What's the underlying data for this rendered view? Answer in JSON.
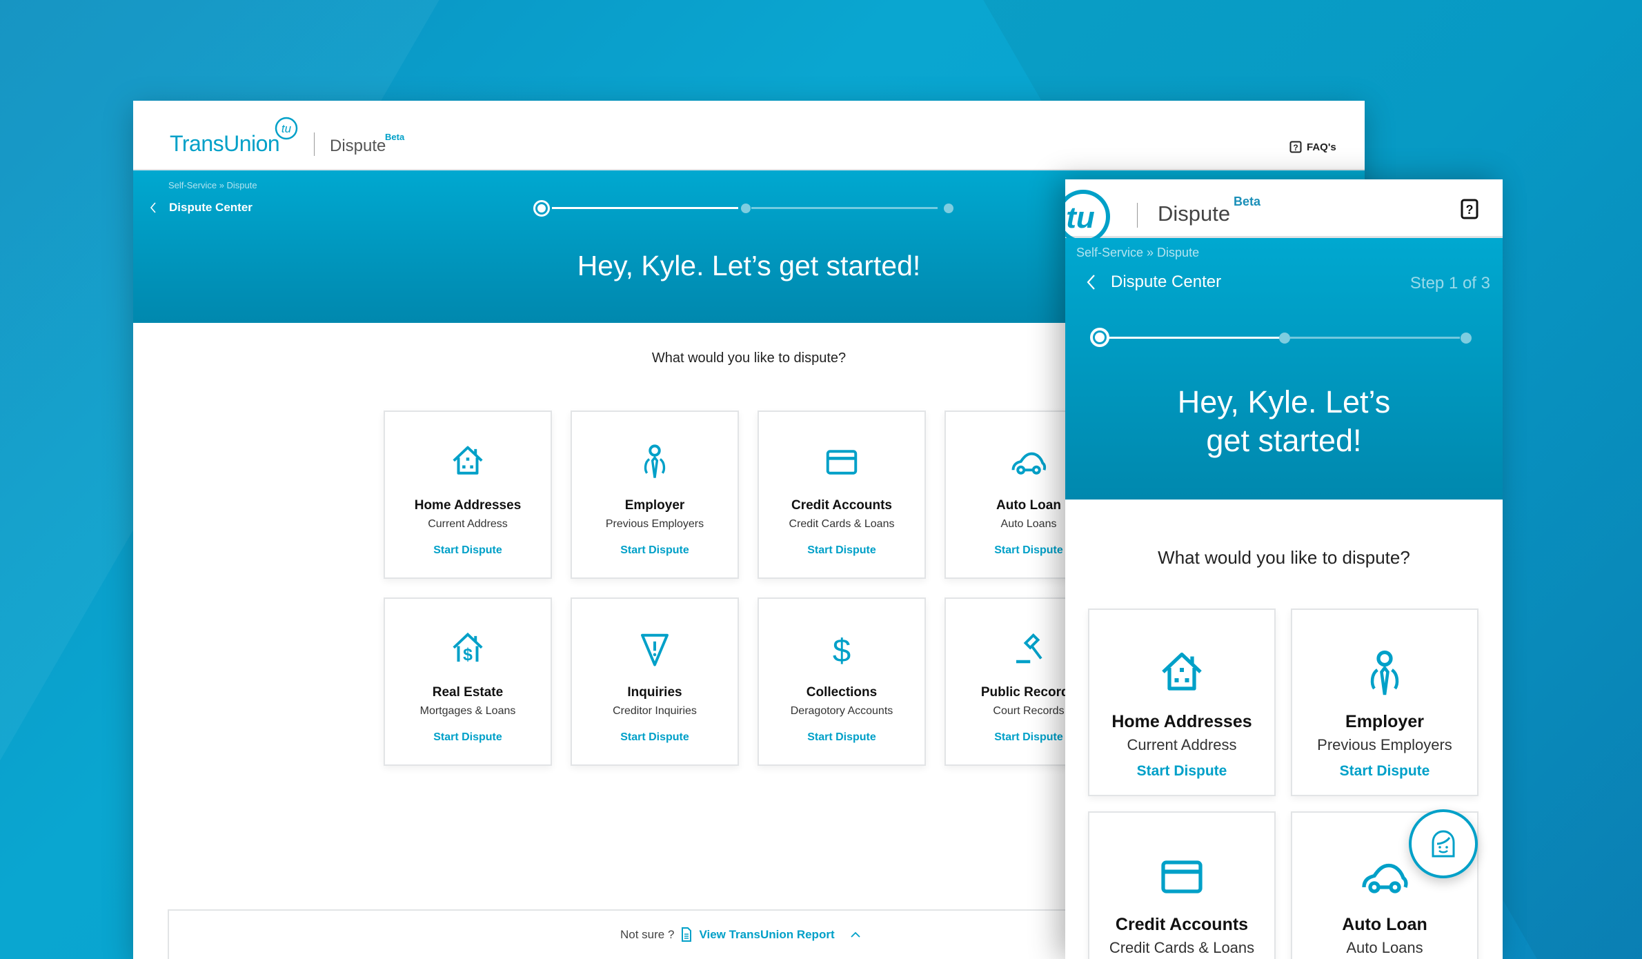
{
  "desktop": {
    "logo": "TransUnion",
    "product": "Dispute",
    "beta": "Beta",
    "faq": "FAQ's",
    "breadcrumb": "Self-Service » Dispute",
    "back_label": "Dispute Center",
    "progress": {
      "current_step": 1,
      "total_steps": 3
    },
    "headline": "Hey, Kyle. Let’s get started!",
    "question": "What would you like to dispute?",
    "cards": [
      {
        "icon": "house-icon",
        "title": "Home Addresses",
        "subtitle": "Current Address",
        "link": "Start Dispute"
      },
      {
        "icon": "employee-icon",
        "title": "Employer",
        "subtitle": "Previous Employers",
        "link": "Start Dispute"
      },
      {
        "icon": "credit-card-icon",
        "title": "Credit Accounts",
        "subtitle": "Credit Cards & Loans",
        "link": "Start Dispute"
      },
      {
        "icon": "car-icon",
        "title": "Auto Loan",
        "subtitle": "Auto Loans",
        "link": "Start Dispute"
      },
      {
        "icon": "house-dollar-icon",
        "title": "Real Estate",
        "subtitle": "Mortgages & Loans",
        "link": "Start Dispute"
      },
      {
        "icon": "warning-triangle-icon",
        "title": "Inquiries",
        "subtitle": "Creditor Inquiries",
        "link": "Start Dispute"
      },
      {
        "icon": "dollar-icon",
        "title": "Collections",
        "subtitle": "Deragotory Accounts",
        "link": "Start Dispute"
      },
      {
        "icon": "gavel-icon",
        "title": "Public Records",
        "subtitle": "Court Records",
        "link": "Start Dispute"
      }
    ],
    "footer": {
      "prompt": "Not sure ?",
      "link": "View TransUnion Report"
    }
  },
  "mobile": {
    "logo": "tu",
    "product": "Dispute",
    "beta": "Beta",
    "breadcrumb": "Self-Service » Dispute",
    "back_label": "Dispute Center",
    "step_text": "Step 1 of 3",
    "headline_line1": "Hey, Kyle. Let’s",
    "headline_line2": "get started!",
    "question": "What would you like to dispute?",
    "cards": [
      {
        "icon": "house-icon",
        "title": "Home Addresses",
        "subtitle": "Current Address",
        "link": "Start Dispute"
      },
      {
        "icon": "employee-icon",
        "title": "Employer",
        "subtitle": "Previous Employers",
        "link": "Start Dispute"
      },
      {
        "icon": "credit-card-icon",
        "title": "Credit Accounts",
        "subtitle": "Credit Cards & Loans",
        "link": ""
      },
      {
        "icon": "car-icon",
        "title": "Auto Loan",
        "subtitle": "Auto Loans",
        "link": ""
      }
    ],
    "chat_icon": "chat-agent-icon"
  },
  "colors": {
    "accent": "#00a0c8",
    "band_top": "#00a8d0",
    "band_bottom": "#0088ae"
  }
}
